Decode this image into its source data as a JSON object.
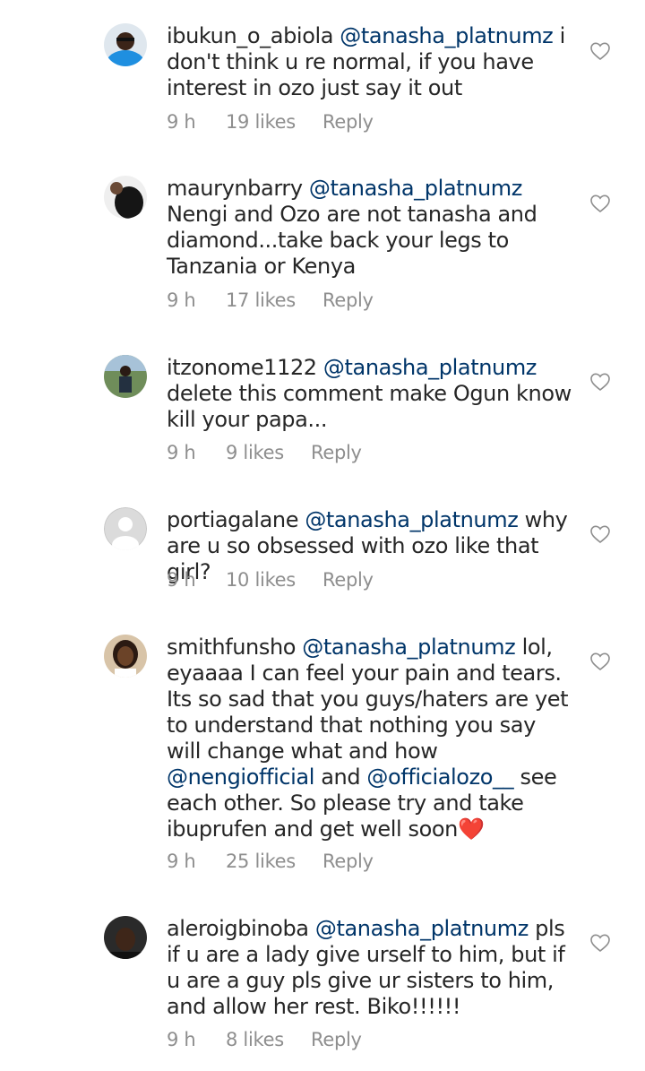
{
  "comments": [
    {
      "username": "ibukun_o_abiola",
      "parts": [
        "@tanasha_platnumz",
        "i don't think u re normal, if you have interest in ozo just say it out"
      ],
      "time": "9 h",
      "likes": "19 likes",
      "reply": "Reply"
    },
    {
      "username": "maurynbarry",
      "parts": [
        "@tanasha_platnumz",
        "Nengi and Ozo are not tanasha and diamond...take back your legs to Tanzania or Kenya"
      ],
      "time": "9 h",
      "likes": "17 likes",
      "reply": "Reply"
    },
    {
      "username": "itzonome1122",
      "parts": [
        "@tanasha_platnumz",
        "delete this comment make Ogun know kill your papa..."
      ],
      "time": "9 h",
      "likes": "9 likes",
      "reply": "Reply"
    },
    {
      "username": "portiagalane",
      "parts": [
        "@tanasha_platnumz",
        "why are u so obsessed with ozo like that girl?"
      ],
      "time": "9 h",
      "likes": "10 likes",
      "reply": "Reply"
    },
    {
      "username": "smithfunsho",
      "parts": [
        "@tanasha_platnumz",
        "lol, eyaaaa I can feel your pain and tears. Its so sad that you guys/haters are yet to understand that nothing you say will change what and how",
        "@nengiofficial",
        "and",
        "@officialozo__",
        "see each other. So please try and take ibuprufen and get well soon",
        "❤️"
      ],
      "time": "9 h",
      "likes": "25 likes",
      "reply": "Reply"
    },
    {
      "username": "aleroigbinoba",
      "parts": [
        "@tanasha_platnumz",
        "pls if u are a lady give urself to him, but if u are a guy pls give ur sisters to him, and allow her rest. Biko!!!!!!"
      ],
      "time": "9 h",
      "likes": "8 likes",
      "reply": "Reply"
    }
  ],
  "colors": {
    "text": "#262626",
    "mention": "#003569",
    "meta": "#8e8e8e",
    "heart_outline": "#8e8e8e",
    "emoji_heart": "#e0262d"
  },
  "icons": {
    "like": "heart-outline-icon",
    "emoji": "red-heart-emoji"
  }
}
